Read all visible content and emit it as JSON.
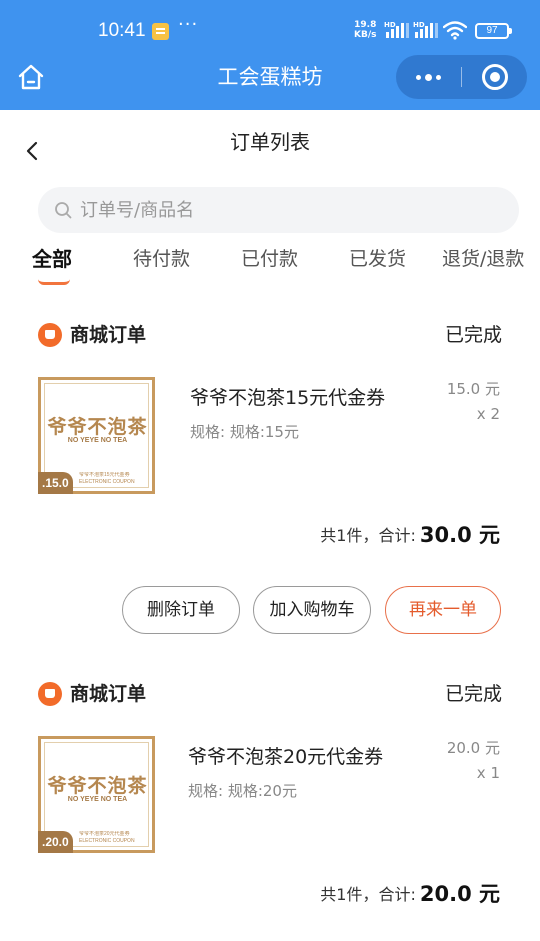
{
  "status_bar": {
    "time": "10:41",
    "more": "···",
    "net_speed_value": "19.8",
    "net_speed_unit": "KB/s",
    "hd1": "HD",
    "hd2": "HD",
    "battery": "97"
  },
  "header": {
    "app_title": "工会蛋糕坊"
  },
  "page": {
    "title": "订单列表"
  },
  "search": {
    "placeholder": "订单号/商品名",
    "value": ""
  },
  "tabs": [
    {
      "label": "全部",
      "active": true
    },
    {
      "label": "待付款",
      "active": false
    },
    {
      "label": "已付款",
      "active": false
    },
    {
      "label": "已发货",
      "active": false
    },
    {
      "label": "退货/退款",
      "active": false
    }
  ],
  "orders": [
    {
      "shop": "商城订单",
      "status": "已完成",
      "item": {
        "logo": "爷爷不泡茶",
        "logo_sub": "NO YEYE NO TEA",
        "badge": ".15.0",
        "strip": "爷爷不泡茶15元代金券",
        "strip_sub": "ELECTRONIC COUPON",
        "name": "爷爷不泡茶15元代金券",
        "spec": "规格: 规格:15元",
        "price": "15.0 元",
        "qty": "x 2"
      },
      "total_label": "共1件，合计:",
      "total_amount": "30.0 元",
      "buttons": {
        "delete": "删除订单",
        "add_cart": "加入购物车",
        "reorder": "再来一单"
      }
    },
    {
      "shop": "商城订单",
      "status": "已完成",
      "item": {
        "logo": "爷爷不泡茶",
        "logo_sub": "NO YEYE NO TEA",
        "badge": ".20.0",
        "strip": "爷爷不泡茶20元代金券",
        "strip_sub": "ELECTRONIC COUPON",
        "name": "爷爷不泡茶20元代金券",
        "spec": "规格: 规格:20元",
        "price": "20.0 元",
        "qty": "x 1"
      },
      "total_label": "共1件，合计:",
      "total_amount": "20.0 元"
    }
  ],
  "colors": {
    "header_blue": "#3f93ef",
    "accent_orange": "#e45b2c",
    "coupon_gold": "#b5874f"
  }
}
